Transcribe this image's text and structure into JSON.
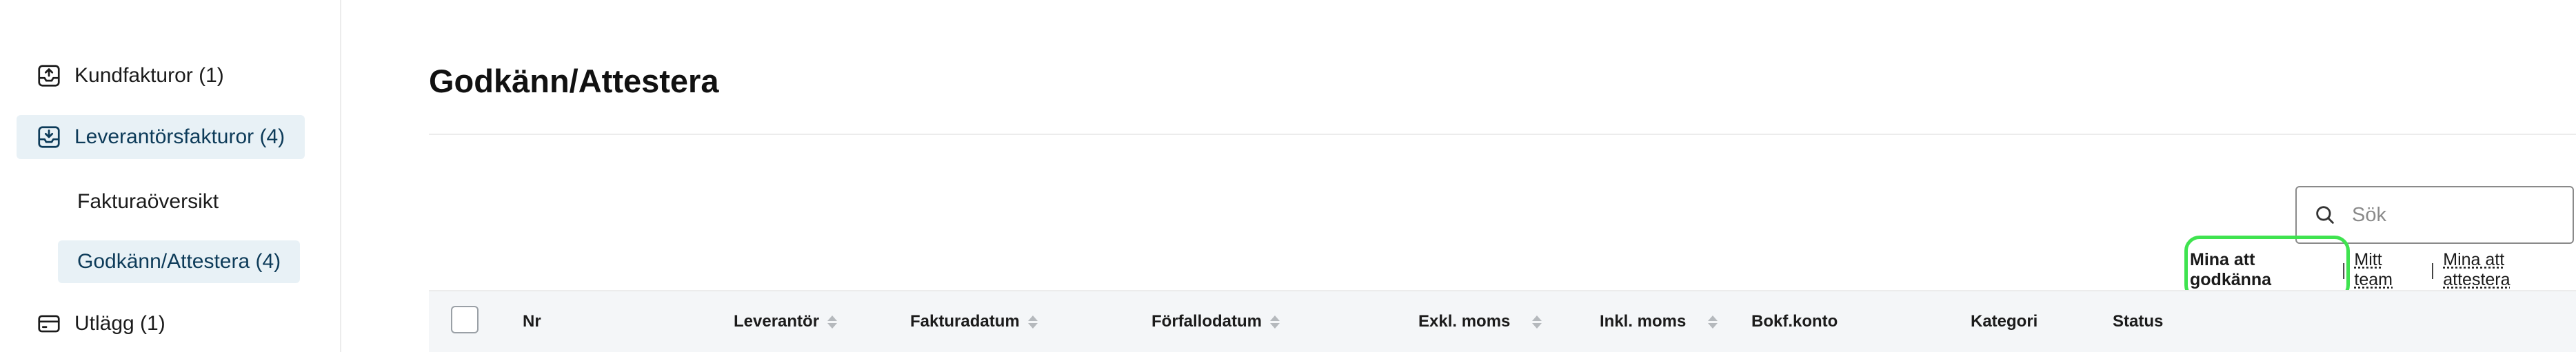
{
  "sidebar": {
    "items": [
      {
        "label": "Kundfakturor (1)",
        "icon": "inbox-upload-icon"
      },
      {
        "label": "Leverantörsfakturor (4)",
        "icon": "inbox-download-icon",
        "active": true
      },
      {
        "label": "Fakturaöversikt"
      },
      {
        "label": "Godkänn/Attestera (4)",
        "active": true
      },
      {
        "label": "Utlägg (1)",
        "icon": "card-icon"
      }
    ]
  },
  "main": {
    "title": "Godkänn/Attestera",
    "search": {
      "placeholder": "Sök",
      "value": ""
    },
    "filters": {
      "active": "Mina att godkänna",
      "mitt_team": "Mitt team",
      "mina_attestera": "Mina att attestera",
      "separator": "|"
    },
    "table": {
      "columns": [
        "Nr",
        "Leverantör",
        "Fakturadatum",
        "Förfallodatum",
        "Exkl. moms",
        "Inkl. moms",
        "Bokf.konto",
        "Kategori",
        "Status"
      ]
    }
  },
  "colors": {
    "accent_bg": "#e8f1f6",
    "highlight": "#3fe34f"
  }
}
